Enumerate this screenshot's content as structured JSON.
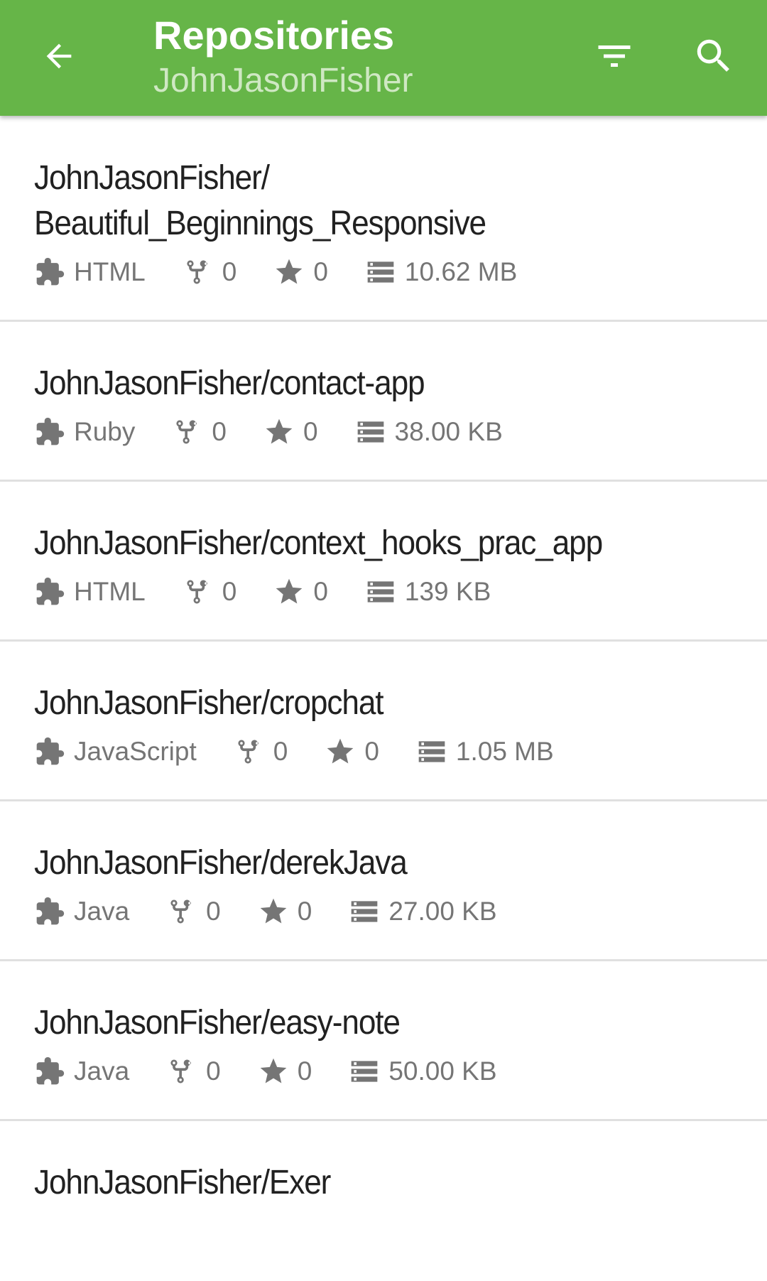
{
  "header": {
    "title": "Repositories",
    "subtitle": "JohnJasonFisher",
    "back_icon": "arrow-back-icon",
    "filter_icon": "filter-icon",
    "search_icon": "search-icon",
    "background": "#66b548"
  },
  "repos": [
    {
      "name": "JohnJasonFisher/\nBeautiful_Beginnings_Responsive",
      "language": "HTML",
      "forks": "0",
      "stars": "0",
      "size": "10.62 MB"
    },
    {
      "name": "JohnJasonFisher/contact-app",
      "language": "Ruby",
      "forks": "0",
      "stars": "0",
      "size": "38.00 KB"
    },
    {
      "name": "JohnJasonFisher/context_hooks_prac_app",
      "language": "HTML",
      "forks": "0",
      "stars": "0",
      "size": "139 KB"
    },
    {
      "name": "JohnJasonFisher/cropchat",
      "language": "JavaScript",
      "forks": "0",
      "stars": "0",
      "size": "1.05 MB"
    },
    {
      "name": "JohnJasonFisher/derekJava",
      "language": "Java",
      "forks": "0",
      "stars": "0",
      "size": "27.00 KB"
    },
    {
      "name": "JohnJasonFisher/easy-note",
      "language": "Java",
      "forks": "0",
      "stars": "0",
      "size": "50.00 KB"
    },
    {
      "name": "JohnJasonFisher/Exer"
    }
  ],
  "icons": {
    "language": "puzzle-icon",
    "forks": "fork-icon",
    "stars": "star-icon",
    "size": "storage-icon"
  }
}
